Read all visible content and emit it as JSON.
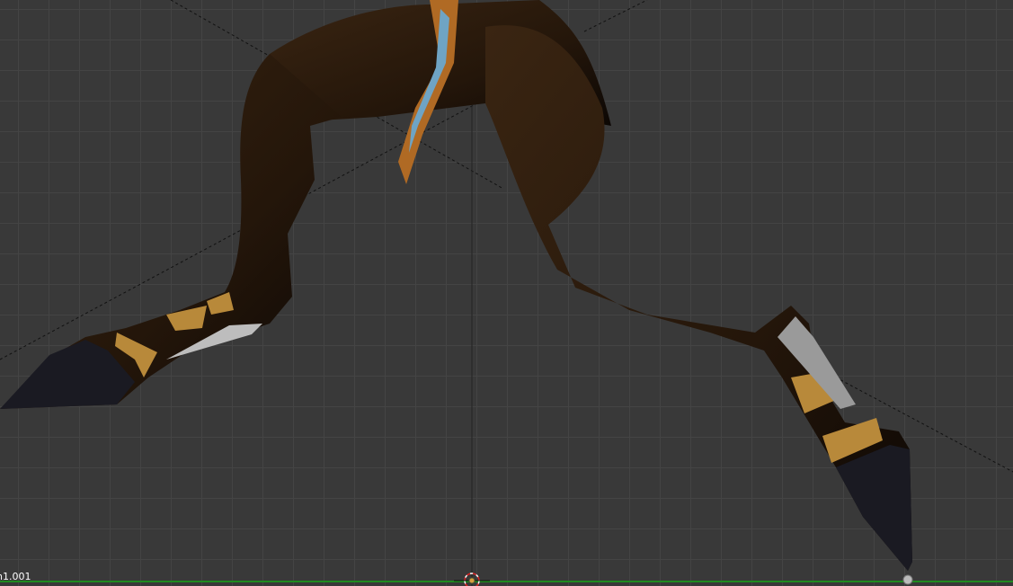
{
  "viewport": {
    "object_name": "n1.001",
    "colors": {
      "background": "#393939",
      "grid": "#444444",
      "x_axis": "#1f8a1f",
      "z_axis": "#2a2aa0",
      "fur": "#2a1a0c",
      "band": "#b8893a",
      "hoof": "#1a1a22"
    }
  }
}
